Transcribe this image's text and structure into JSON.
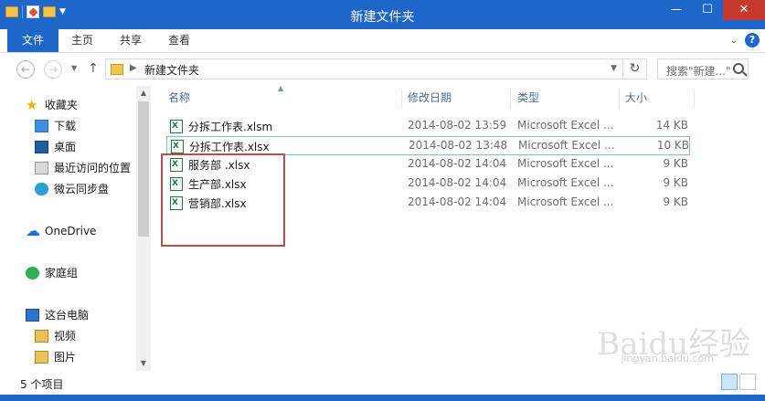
{
  "window": {
    "title": "新建文件夹"
  },
  "ribbon": {
    "tabs": [
      "文件",
      "主页",
      "共享",
      "查看"
    ]
  },
  "address": {
    "path": "新建文件夹",
    "search_placeholder": "搜索\"新建...\""
  },
  "nav": {
    "items": [
      {
        "label": "收藏夹",
        "icon": "star-icon"
      },
      {
        "label": "下载",
        "icon": "download-folder-icon"
      },
      {
        "label": "桌面",
        "icon": "desktop-icon"
      },
      {
        "label": "最近访问的位置",
        "icon": "recent-places-icon"
      },
      {
        "label": "微云同步盘",
        "icon": "weiyun-cloud-icon"
      },
      {
        "label": "OneDrive",
        "icon": "onedrive-cloud-icon"
      },
      {
        "label": "家庭组",
        "icon": "homegroup-icon"
      },
      {
        "label": "这台电脑",
        "icon": "this-pc-icon"
      },
      {
        "label": "视频",
        "icon": "videos-folder-icon"
      },
      {
        "label": "图片",
        "icon": "pictures-folder-icon"
      }
    ]
  },
  "columns": {
    "name": "名称",
    "date": "修改日期",
    "type": "类型",
    "size": "大小"
  },
  "files": [
    {
      "name": "分拆工作表.xlsm",
      "date": "2014-08-02 13:59",
      "type": "Microsoft Excel ...",
      "size": "14 KB"
    },
    {
      "name": "分拆工作表.xlsx",
      "date": "2014-08-02 13:48",
      "type": "Microsoft Excel ...",
      "size": "10 KB"
    },
    {
      "name": "服务部 .xlsx",
      "date": "2014-08-02 14:04",
      "type": "Microsoft Excel ...",
      "size": "9 KB"
    },
    {
      "name": "生产部.xlsx",
      "date": "2014-08-02 14:04",
      "type": "Microsoft Excel ...",
      "size": "9 KB"
    },
    {
      "name": "营销部.xlsx",
      "date": "2014-08-02 14:04",
      "type": "Microsoft Excel ...",
      "size": "9 KB"
    }
  ],
  "status": {
    "count": "5 个项目"
  },
  "watermark": {
    "text": "Baidu经验",
    "url": "jingyan.baidu.com"
  }
}
